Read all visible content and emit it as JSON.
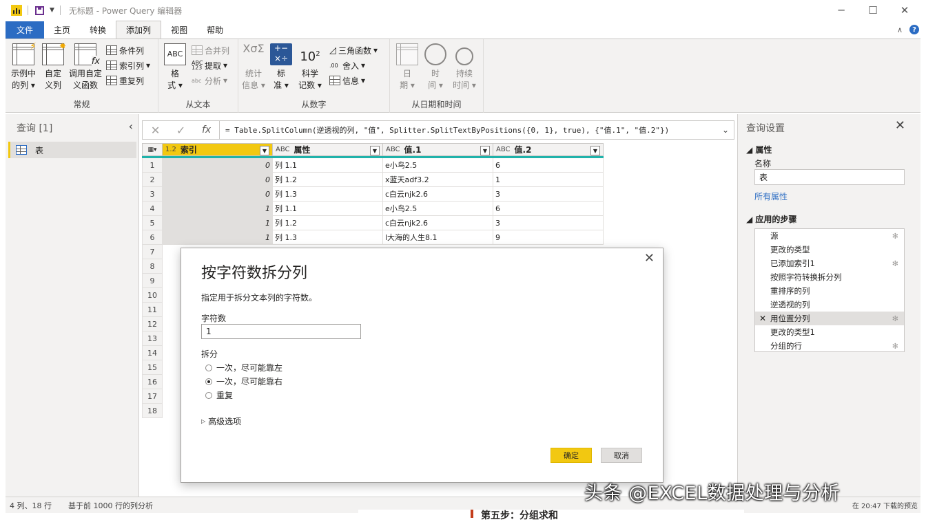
{
  "window": {
    "title": "无标题 - Power Query 编辑器"
  },
  "menu": {
    "file": "文件",
    "tabs": [
      "主页",
      "转换",
      "添加列",
      "视图",
      "帮助"
    ],
    "active_index": 2,
    "help": "?"
  },
  "ribbon": {
    "groups": {
      "general": {
        "label": "常规",
        "example_col": [
          "示例中",
          "的列"
        ],
        "custom_col": [
          "自定",
          "义列"
        ],
        "invoke_func": [
          "调用自定",
          "义函数"
        ],
        "conditional": "条件列",
        "index": "索引列",
        "duplicate": "重复列"
      },
      "from_text": {
        "label": "从文本",
        "format": [
          "格",
          "式"
        ],
        "merge": "合并列",
        "extract": "提取",
        "parse": "分析"
      },
      "from_number": {
        "label": "从数字",
        "stats": [
          "统计",
          "信息"
        ],
        "standard": [
          "标",
          "准"
        ],
        "scientific": [
          "科学",
          "记数"
        ],
        "trig": "三角函数",
        "rounding": "舍入",
        "info": "信息"
      },
      "from_datetime": {
        "label": "从日期和时间",
        "date": [
          "日",
          "期"
        ],
        "time": [
          "时",
          "间"
        ],
        "duration": [
          "持续",
          "时间"
        ]
      }
    }
  },
  "queries": {
    "title": "查询 [1]",
    "items": [
      "表"
    ]
  },
  "formula": "= Table.SplitColumn(逆透视的列, \"值\", Splitter.SplitTextByPositions({0, 1}, true), {\"值.1\", \"值.2\"})",
  "grid": {
    "columns": [
      {
        "type": "1.2",
        "name": "索引"
      },
      {
        "type": "ABC",
        "name": "属性"
      },
      {
        "type": "ABC",
        "name": "值.1"
      },
      {
        "type": "ABC",
        "name": "值.2"
      }
    ],
    "rows": [
      [
        "0",
        "列 1.1",
        "e小鸟2.5",
        "6"
      ],
      [
        "0",
        "列 1.2",
        "x蓝天adf3.2",
        "1"
      ],
      [
        "0",
        "列 1.3",
        "c白云njk2.6",
        "3"
      ],
      [
        "1",
        "列 1.1",
        "e小鸟2.5",
        "6"
      ],
      [
        "1",
        "列 1.2",
        "c白云njk2.6",
        "3"
      ],
      [
        "1",
        "列 1.3",
        "l大海的人生8.1",
        "9"
      ]
    ],
    "row_numbers": [
      "1",
      "2",
      "3",
      "4",
      "5",
      "6",
      "7",
      "8",
      "9",
      "10",
      "11",
      "12",
      "13",
      "14",
      "15",
      "16",
      "17",
      "18"
    ]
  },
  "settings": {
    "title": "查询设置",
    "properties": "属性",
    "name_label": "名称",
    "name_value": "表",
    "all_props": "所有属性",
    "steps_title": "应用的步骤",
    "steps": [
      "源",
      "更改的类型",
      "已添加索引1",
      "按照字符转换拆分列",
      "重排序的列",
      "逆透视的列",
      "用位置分列",
      "更改的类型1",
      "分组的行"
    ],
    "selected_step": 6
  },
  "dialog": {
    "title": "按字符数拆分列",
    "description": "指定用于拆分文本列的字符数。",
    "chars_label": "字符数",
    "chars_value": "1",
    "split_label": "拆分",
    "options": [
      "一次，尽可能靠左",
      "一次，尽可能靠右",
      "重复"
    ],
    "selected_option": 1,
    "advanced": "高级选项",
    "ok": "确定",
    "cancel": "取消"
  },
  "status": {
    "cols_rows": "4 列、18 行",
    "profile": "基于前 1000 行的列分析",
    "preview": "在 20:47 下载的预览"
  },
  "watermark": "头条 @EXCEL数据处理与分析",
  "background_heading": "第五步：分组求和",
  "colors": {
    "accent": "#f2c811",
    "file_tab": "#2b6cc3",
    "column_quality": "#20b2aa"
  }
}
